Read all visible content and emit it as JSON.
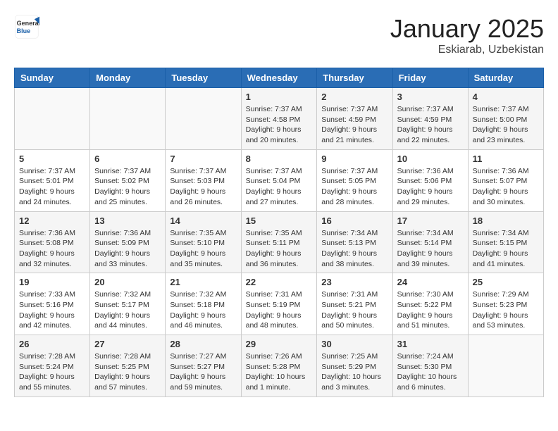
{
  "header": {
    "logo_general": "General",
    "logo_blue": "Blue",
    "month_title": "January 2025",
    "location": "Eskiarab, Uzbekistan"
  },
  "weekdays": [
    "Sunday",
    "Monday",
    "Tuesday",
    "Wednesday",
    "Thursday",
    "Friday",
    "Saturday"
  ],
  "weeks": [
    [
      {
        "day": "",
        "info": ""
      },
      {
        "day": "",
        "info": ""
      },
      {
        "day": "",
        "info": ""
      },
      {
        "day": "1",
        "info": "Sunrise: 7:37 AM\nSunset: 4:58 PM\nDaylight: 9 hours\nand 20 minutes."
      },
      {
        "day": "2",
        "info": "Sunrise: 7:37 AM\nSunset: 4:59 PM\nDaylight: 9 hours\nand 21 minutes."
      },
      {
        "day": "3",
        "info": "Sunrise: 7:37 AM\nSunset: 4:59 PM\nDaylight: 9 hours\nand 22 minutes."
      },
      {
        "day": "4",
        "info": "Sunrise: 7:37 AM\nSunset: 5:00 PM\nDaylight: 9 hours\nand 23 minutes."
      }
    ],
    [
      {
        "day": "5",
        "info": "Sunrise: 7:37 AM\nSunset: 5:01 PM\nDaylight: 9 hours\nand 24 minutes."
      },
      {
        "day": "6",
        "info": "Sunrise: 7:37 AM\nSunset: 5:02 PM\nDaylight: 9 hours\nand 25 minutes."
      },
      {
        "day": "7",
        "info": "Sunrise: 7:37 AM\nSunset: 5:03 PM\nDaylight: 9 hours\nand 26 minutes."
      },
      {
        "day": "8",
        "info": "Sunrise: 7:37 AM\nSunset: 5:04 PM\nDaylight: 9 hours\nand 27 minutes."
      },
      {
        "day": "9",
        "info": "Sunrise: 7:37 AM\nSunset: 5:05 PM\nDaylight: 9 hours\nand 28 minutes."
      },
      {
        "day": "10",
        "info": "Sunrise: 7:36 AM\nSunset: 5:06 PM\nDaylight: 9 hours\nand 29 minutes."
      },
      {
        "day": "11",
        "info": "Sunrise: 7:36 AM\nSunset: 5:07 PM\nDaylight: 9 hours\nand 30 minutes."
      }
    ],
    [
      {
        "day": "12",
        "info": "Sunrise: 7:36 AM\nSunset: 5:08 PM\nDaylight: 9 hours\nand 32 minutes."
      },
      {
        "day": "13",
        "info": "Sunrise: 7:36 AM\nSunset: 5:09 PM\nDaylight: 9 hours\nand 33 minutes."
      },
      {
        "day": "14",
        "info": "Sunrise: 7:35 AM\nSunset: 5:10 PM\nDaylight: 9 hours\nand 35 minutes."
      },
      {
        "day": "15",
        "info": "Sunrise: 7:35 AM\nSunset: 5:11 PM\nDaylight: 9 hours\nand 36 minutes."
      },
      {
        "day": "16",
        "info": "Sunrise: 7:34 AM\nSunset: 5:13 PM\nDaylight: 9 hours\nand 38 minutes."
      },
      {
        "day": "17",
        "info": "Sunrise: 7:34 AM\nSunset: 5:14 PM\nDaylight: 9 hours\nand 39 minutes."
      },
      {
        "day": "18",
        "info": "Sunrise: 7:34 AM\nSunset: 5:15 PM\nDaylight: 9 hours\nand 41 minutes."
      }
    ],
    [
      {
        "day": "19",
        "info": "Sunrise: 7:33 AM\nSunset: 5:16 PM\nDaylight: 9 hours\nand 42 minutes."
      },
      {
        "day": "20",
        "info": "Sunrise: 7:32 AM\nSunset: 5:17 PM\nDaylight: 9 hours\nand 44 minutes."
      },
      {
        "day": "21",
        "info": "Sunrise: 7:32 AM\nSunset: 5:18 PM\nDaylight: 9 hours\nand 46 minutes."
      },
      {
        "day": "22",
        "info": "Sunrise: 7:31 AM\nSunset: 5:19 PM\nDaylight: 9 hours\nand 48 minutes."
      },
      {
        "day": "23",
        "info": "Sunrise: 7:31 AM\nSunset: 5:21 PM\nDaylight: 9 hours\nand 50 minutes."
      },
      {
        "day": "24",
        "info": "Sunrise: 7:30 AM\nSunset: 5:22 PM\nDaylight: 9 hours\nand 51 minutes."
      },
      {
        "day": "25",
        "info": "Sunrise: 7:29 AM\nSunset: 5:23 PM\nDaylight: 9 hours\nand 53 minutes."
      }
    ],
    [
      {
        "day": "26",
        "info": "Sunrise: 7:28 AM\nSunset: 5:24 PM\nDaylight: 9 hours\nand 55 minutes."
      },
      {
        "day": "27",
        "info": "Sunrise: 7:28 AM\nSunset: 5:25 PM\nDaylight: 9 hours\nand 57 minutes."
      },
      {
        "day": "28",
        "info": "Sunrise: 7:27 AM\nSunset: 5:27 PM\nDaylight: 9 hours\nand 59 minutes."
      },
      {
        "day": "29",
        "info": "Sunrise: 7:26 AM\nSunset: 5:28 PM\nDaylight: 10 hours\nand 1 minute."
      },
      {
        "day": "30",
        "info": "Sunrise: 7:25 AM\nSunset: 5:29 PM\nDaylight: 10 hours\nand 3 minutes."
      },
      {
        "day": "31",
        "info": "Sunrise: 7:24 AM\nSunset: 5:30 PM\nDaylight: 10 hours\nand 6 minutes."
      },
      {
        "day": "",
        "info": ""
      }
    ]
  ]
}
